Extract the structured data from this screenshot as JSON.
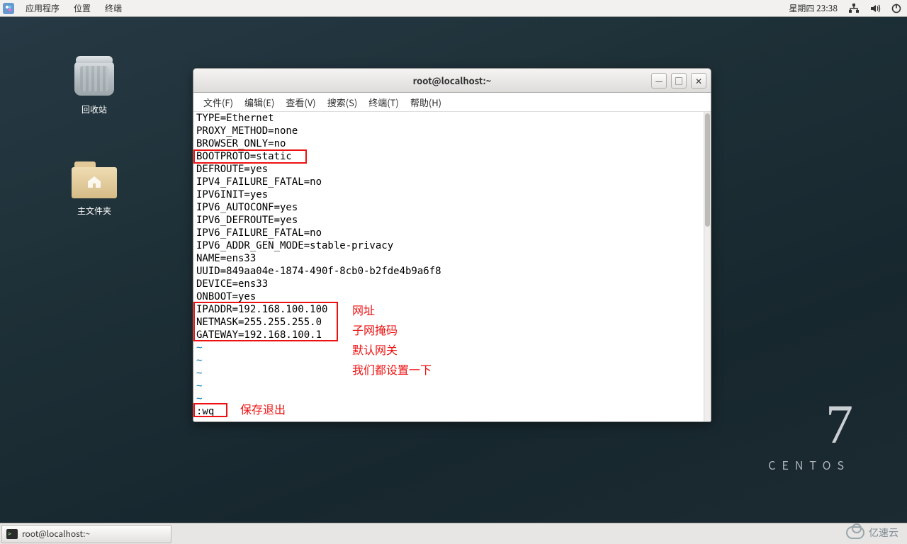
{
  "panel": {
    "menu": {
      "apps": "应用程序",
      "places": "位置",
      "terminal": "终端"
    },
    "clock": "星期四 23:38"
  },
  "desktop": {
    "trash": "回收站",
    "home": "主文件夹"
  },
  "brand": {
    "seven": "7",
    "name": "CENTOS"
  },
  "window": {
    "title": "root@localhost:~",
    "menu": {
      "file": "文件(F)",
      "edit": "编辑(E)",
      "view": "查看(V)",
      "search": "搜索(S)",
      "terminal": "终端(T)",
      "help": "帮助(H)"
    }
  },
  "file_lines": [
    "TYPE=Ethernet",
    "PROXY_METHOD=none",
    "BROWSER_ONLY=no",
    "BOOTPROTO=static",
    "DEFROUTE=yes",
    "IPV4_FAILURE_FATAL=no",
    "IPV6INIT=yes",
    "IPV6_AUTOCONF=yes",
    "IPV6_DEFROUTE=yes",
    "IPV6_FAILURE_FATAL=no",
    "IPV6_ADDR_GEN_MODE=stable-privacy",
    "NAME=ens33",
    "UUID=849aa04e-1874-490f-8cb0-b2fde4b9a6f8",
    "DEVICE=ens33",
    "ONBOOT=yes",
    "IPADDR=192.168.100.100",
    "NETMASK=255.255.255.0",
    "GATEWAY=192.168.100.1"
  ],
  "tilde": "~",
  "vim_cmd": ":wq",
  "annotations": {
    "addr": "网址",
    "mask": "子网掩码",
    "gw": "默认网关",
    "set_all": "我们都设置一下",
    "save": "保存退出"
  },
  "taskbar": {
    "task1": "root@localhost:~"
  },
  "watermark": "亿速云"
}
